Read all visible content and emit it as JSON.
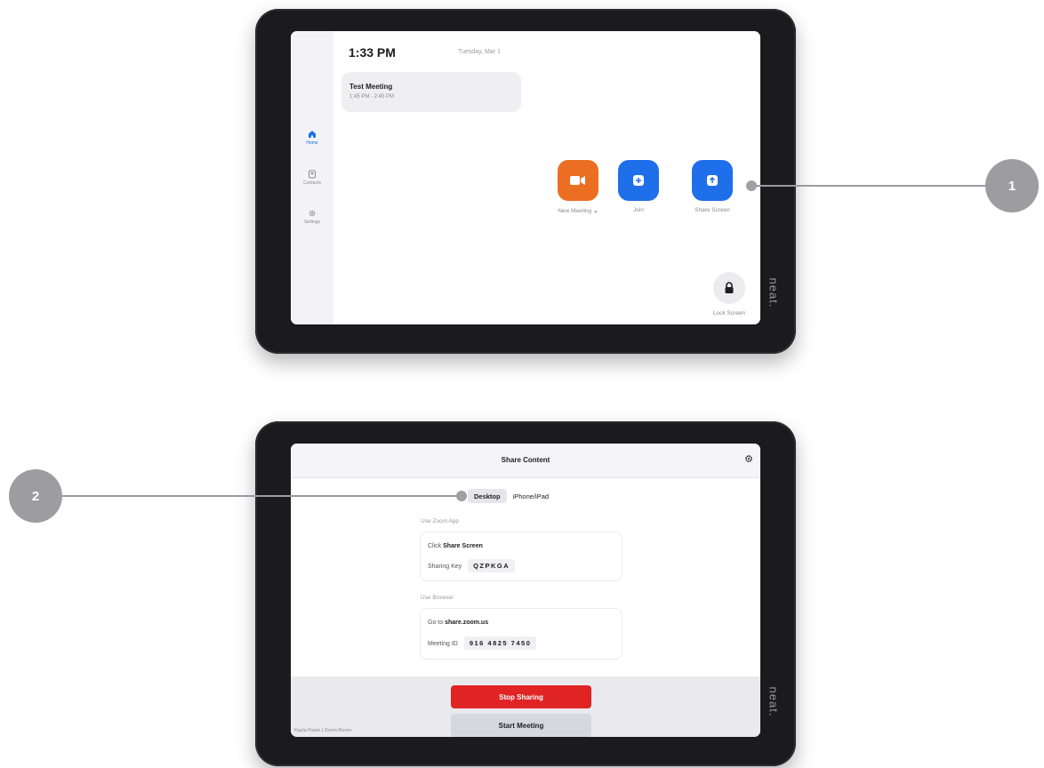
{
  "home": {
    "time": "1:33 PM",
    "date": "Tuesday, Mar 1",
    "meeting": {
      "title": "Test Meeting",
      "time": "1:45 PM - 2:45 PM"
    },
    "sidebar": [
      {
        "label": "Home",
        "icon": "home-icon"
      },
      {
        "label": "Contacts",
        "icon": "contacts-icon"
      },
      {
        "label": "Settings",
        "icon": "settings-icon"
      }
    ],
    "actions": {
      "new_meeting": "New Meeting",
      "join": "Join",
      "share_screen": "Share Screen",
      "lock_screen": "Lock Screen"
    },
    "brand": "neat."
  },
  "callouts": {
    "first": "1",
    "second": "2"
  },
  "share": {
    "title": "Share Content",
    "tabs": [
      "Desktop",
      "iPhone/iPad"
    ],
    "use_zoom_app": "Use Zoom App",
    "click_label": "Click",
    "click_value": "Share Screen",
    "sharing_key_label": "Sharing Key",
    "sharing_key": "QZPKGA",
    "use_browser": "Use Browser",
    "go_to_label": "Go to",
    "go_to_value": "share.zoom.us",
    "meeting_id_label": "Meeting ID",
    "meeting_id": "916 4825 7450",
    "stop_sharing": "Stop Sharing",
    "start_meeting": "Start Meeting",
    "footer": "Kayla Pasto | Zoom Room",
    "brand": "neat."
  },
  "colors": {
    "orange": "#ec6e22",
    "blue": "#1f6fea",
    "red": "#e02424"
  }
}
